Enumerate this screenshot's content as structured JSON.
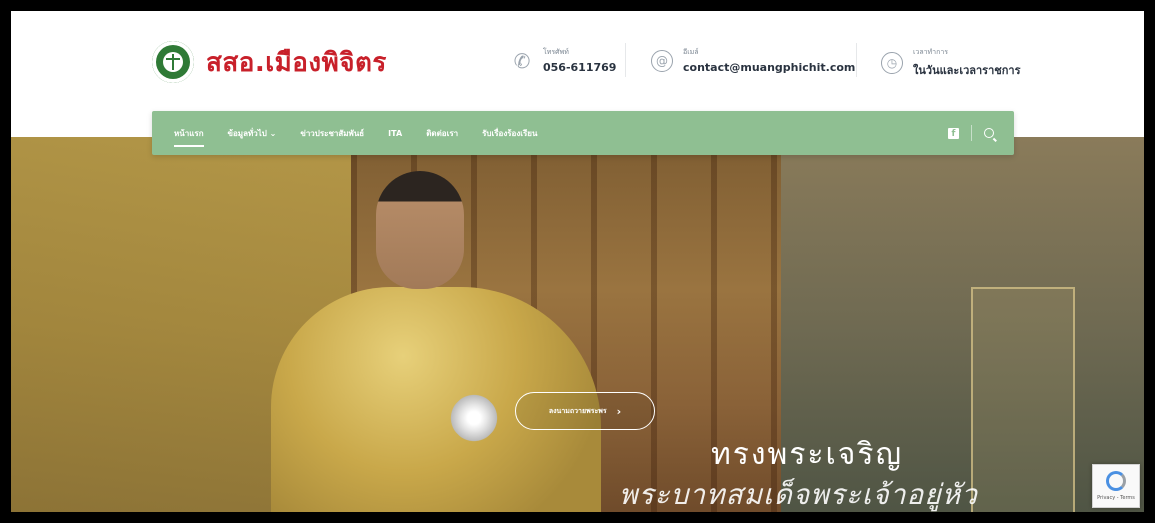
{
  "header": {
    "site_title": "สสอ.เมืองพิจิตร",
    "phone": {
      "label": "โทรศัพท์",
      "value": "056-611769",
      "icon": "phone-icon"
    },
    "email": {
      "label": "อีเมล์",
      "value": "contact@muangphichit.com",
      "icon": "at-sign-icon"
    },
    "hours": {
      "label": "เวลาทำการ",
      "value": "ในวันและเวลาราชการ",
      "icon": "clock-icon"
    }
  },
  "nav": {
    "items": [
      {
        "label": "หน้าแรก",
        "active": true
      },
      {
        "label": "ข้อมูลทั่วไป ⌄",
        "active": false
      },
      {
        "label": "ข่าวประชาสัมพันธ์",
        "active": false
      },
      {
        "label": "ITA",
        "active": false
      },
      {
        "label": "ติดต่อเรา",
        "active": false
      },
      {
        "label": "รับเรื่องร้องเรียน",
        "active": false
      }
    ],
    "facebook_icon": "facebook-icon",
    "search_icon": "search-icon"
  },
  "hero": {
    "button_label": "ลงนามถวายพระพร",
    "line1": "ทรงพระเจริญ",
    "line2": "พระบาทสมเด็จพระเจ้าอยู่หัว"
  },
  "recaptcha": {
    "text": "Privacy - Terms"
  },
  "colors": {
    "brand_red": "#c8202a",
    "nav_green": "#8fbf92",
    "logo_green": "#2f7a36"
  }
}
